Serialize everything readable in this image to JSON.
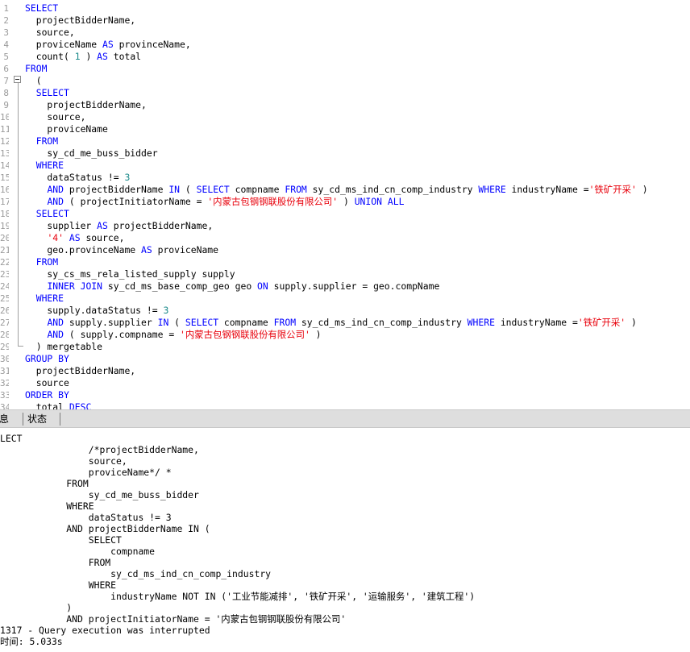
{
  "editor": {
    "lines": [
      {
        "n": "1",
        "t": [
          {
            "k": "kw",
            "v": "SELECT"
          }
        ]
      },
      {
        "n": "2",
        "t": [
          {
            "v": "  projectBidderName,"
          }
        ]
      },
      {
        "n": "3",
        "t": [
          {
            "v": "  source,"
          }
        ]
      },
      {
        "n": "4",
        "t": [
          {
            "v": "  proviceName "
          },
          {
            "k": "kw",
            "v": "AS"
          },
          {
            "v": " provinceName,"
          }
        ]
      },
      {
        "n": "5",
        "t": [
          {
            "v": "  count( "
          },
          {
            "k": "num",
            "v": "1"
          },
          {
            "v": " ) "
          },
          {
            "k": "kw",
            "v": "AS"
          },
          {
            "v": " total"
          }
        ]
      },
      {
        "n": "6",
        "t": [
          {
            "v": ""
          },
          {
            "k": "kw",
            "v": "FROM"
          }
        ]
      },
      {
        "n": "7",
        "t": [
          {
            "v": "  ("
          }
        ]
      },
      {
        "n": "8",
        "t": [
          {
            "v": "  "
          },
          {
            "k": "kw",
            "v": "SELECT"
          }
        ]
      },
      {
        "n": "9",
        "t": [
          {
            "v": "    projectBidderName,"
          }
        ]
      },
      {
        "n": "10",
        "t": [
          {
            "v": "    source,"
          }
        ]
      },
      {
        "n": "11",
        "t": [
          {
            "v": "    proviceName"
          }
        ]
      },
      {
        "n": "12",
        "t": [
          {
            "v": "  "
          },
          {
            "k": "kw",
            "v": "FROM"
          }
        ]
      },
      {
        "n": "13",
        "t": [
          {
            "v": "    sy_cd_me_buss_bidder"
          }
        ]
      },
      {
        "n": "14",
        "t": [
          {
            "v": "  "
          },
          {
            "k": "kw",
            "v": "WHERE"
          }
        ]
      },
      {
        "n": "15",
        "t": [
          {
            "v": "    dataStatus != "
          },
          {
            "k": "num",
            "v": "3"
          }
        ]
      },
      {
        "n": "16",
        "t": [
          {
            "v": "    "
          },
          {
            "k": "kw",
            "v": "AND"
          },
          {
            "v": " projectBidderName "
          },
          {
            "k": "kw",
            "v": "IN"
          },
          {
            "v": " ( "
          },
          {
            "k": "kw",
            "v": "SELECT"
          },
          {
            "v": " compname "
          },
          {
            "k": "kw",
            "v": "FROM"
          },
          {
            "v": " sy_cd_ms_ind_cn_comp_industry "
          },
          {
            "k": "kw",
            "v": "WHERE"
          },
          {
            "v": " industryName ="
          },
          {
            "k": "str",
            "v": "'铁矿开采'"
          },
          {
            "v": " )"
          }
        ]
      },
      {
        "n": "17",
        "t": [
          {
            "v": "    "
          },
          {
            "k": "kw",
            "v": "AND"
          },
          {
            "v": " ( projectInitiatorName = "
          },
          {
            "k": "str",
            "v": "'内蒙古包钢钢联股份有限公司'"
          },
          {
            "v": " ) "
          },
          {
            "k": "kw",
            "v": "UNION ALL"
          }
        ]
      },
      {
        "n": "18",
        "t": [
          {
            "v": "  "
          },
          {
            "k": "kw",
            "v": "SELECT"
          }
        ]
      },
      {
        "n": "19",
        "t": [
          {
            "v": "    supplier "
          },
          {
            "k": "kw",
            "v": "AS"
          },
          {
            "v": " projectBidderName,"
          }
        ]
      },
      {
        "n": "20",
        "t": [
          {
            "v": "    "
          },
          {
            "k": "str",
            "v": "'4'"
          },
          {
            "v": " "
          },
          {
            "k": "kw",
            "v": "AS"
          },
          {
            "v": " source,"
          }
        ]
      },
      {
        "n": "21",
        "t": [
          {
            "v": "    geo.provinceName "
          },
          {
            "k": "kw",
            "v": "AS"
          },
          {
            "v": " proviceName"
          }
        ]
      },
      {
        "n": "22",
        "t": [
          {
            "v": "  "
          },
          {
            "k": "kw",
            "v": "FROM"
          }
        ]
      },
      {
        "n": "23",
        "t": [
          {
            "v": "    sy_cs_ms_rela_listed_supply supply"
          }
        ]
      },
      {
        "n": "24",
        "t": [
          {
            "v": "    "
          },
          {
            "k": "kw",
            "v": "INNER JOIN"
          },
          {
            "v": " sy_cd_ms_base_comp_geo geo "
          },
          {
            "k": "kw",
            "v": "ON"
          },
          {
            "v": " supply.supplier = geo.compName"
          }
        ]
      },
      {
        "n": "25",
        "t": [
          {
            "v": "  "
          },
          {
            "k": "kw",
            "v": "WHERE"
          }
        ]
      },
      {
        "n": "26",
        "t": [
          {
            "v": "    supply.dataStatus != "
          },
          {
            "k": "num",
            "v": "3"
          }
        ]
      },
      {
        "n": "27",
        "t": [
          {
            "v": "    "
          },
          {
            "k": "kw",
            "v": "AND"
          },
          {
            "v": " supply.supplier "
          },
          {
            "k": "kw",
            "v": "IN"
          },
          {
            "v": " ( "
          },
          {
            "k": "kw",
            "v": "SELECT"
          },
          {
            "v": " compname "
          },
          {
            "k": "kw",
            "v": "FROM"
          },
          {
            "v": " sy_cd_ms_ind_cn_comp_industry "
          },
          {
            "k": "kw",
            "v": "WHERE"
          },
          {
            "v": " industryName ="
          },
          {
            "k": "str",
            "v": "'铁矿开采'"
          },
          {
            "v": " )"
          }
        ]
      },
      {
        "n": "28",
        "t": [
          {
            "v": "    "
          },
          {
            "k": "kw",
            "v": "AND"
          },
          {
            "v": " ( supply.compname = "
          },
          {
            "k": "str",
            "v": "'内蒙古包钢钢联股份有限公司'"
          },
          {
            "v": " )"
          }
        ]
      },
      {
        "n": "29",
        "t": [
          {
            "v": "  ) mergetable"
          }
        ]
      },
      {
        "n": "30",
        "t": [
          {
            "v": ""
          },
          {
            "k": "kw",
            "v": "GROUP BY"
          }
        ]
      },
      {
        "n": "31",
        "t": [
          {
            "v": "  projectBidderName,"
          }
        ]
      },
      {
        "n": "32",
        "t": [
          {
            "v": "  source"
          }
        ]
      },
      {
        "n": "33",
        "t": [
          {
            "v": ""
          },
          {
            "k": "kw",
            "v": "ORDER BY"
          }
        ]
      },
      {
        "n": "34",
        "t": [
          {
            "v": "  total "
          },
          {
            "k": "kw",
            "v": "DESC"
          }
        ]
      }
    ]
  },
  "tabs": [
    {
      "label": "息"
    },
    {
      "label": "状态"
    }
  ],
  "output": {
    "lines": [
      "LECT",
      "                /*projectBidderName,",
      "                source,",
      "                proviceName*/ *",
      "            FROM",
      "                sy_cd_me_buss_bidder",
      "            WHERE",
      "                dataStatus != 3",
      "            AND projectBidderName IN (",
      "                SELECT",
      "                    compname",
      "                FROM",
      "                    sy_cd_ms_ind_cn_comp_industry",
      "                WHERE",
      "                    industryName NOT IN ('工业节能减排', '铁矿开采', '运输服务', '建筑工程')",
      "            )",
      "            AND projectInitiatorName = '内蒙古包钢钢联股份有限公司'",
      "1317 - Query execution was interrupted",
      "时间: 5.033s"
    ]
  }
}
